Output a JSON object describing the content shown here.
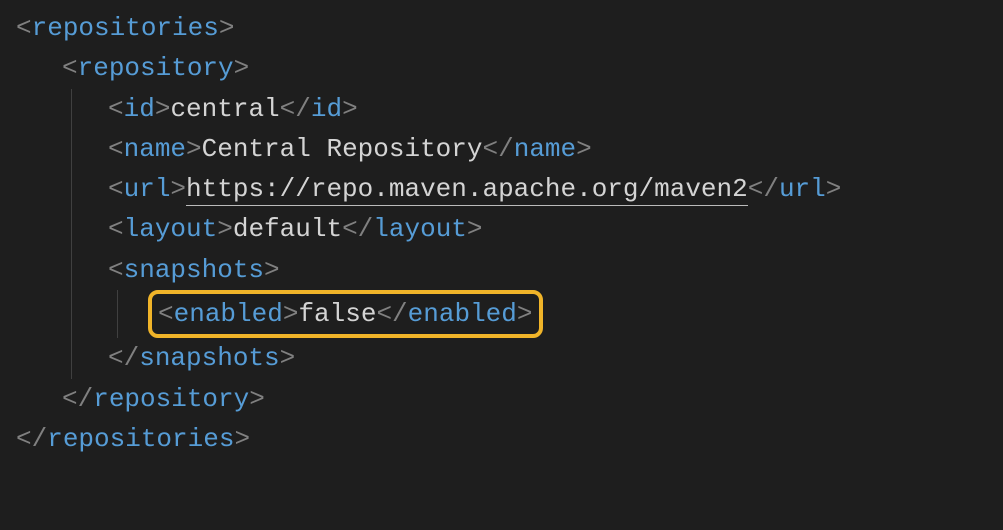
{
  "tags": {
    "repositories": "repositories",
    "repository": "repository",
    "id": "id",
    "name": "name",
    "url": "url",
    "layout": "layout",
    "snapshots": "snapshots",
    "enabled": "enabled"
  },
  "values": {
    "id": "central",
    "name": "Central Repository",
    "url": "https://repo.maven.apache.org/maven2",
    "layout": "default",
    "enabled": "false"
  }
}
